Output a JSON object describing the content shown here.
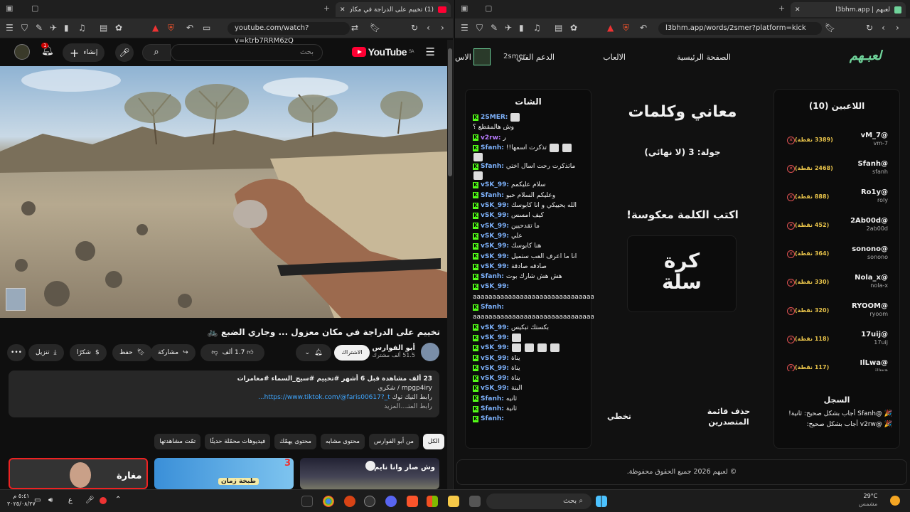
{
  "left": {
    "tab_title": "(1) تخييم على الدراجة في مكان",
    "url": "youtube.com/watch?v=ktrb7RRM6zQ",
    "yt_logo": "YouTube",
    "yt_region": "SA",
    "search_placeholder": "بحث",
    "create_label": "إنشاء",
    "notif_badge": "1",
    "video_title": "تخييم على الدراجة في مكان معزول ... وجاري الضبع 🚲",
    "channel_name": "أبو الفوارس",
    "subscribers": "51.5 ألف مشترك",
    "subscribe_label": "الاشتراك",
    "like_count": "1.7 ألف",
    "share_label": "مشاركة",
    "save_label": "حفظ",
    "thanks_label": "شكرًا",
    "download_label": "تنزيل",
    "desc_meta": "23 ألف مشاهدة  قبل 6 أشهر  #تخييم #سيج_السماء #مغامرات",
    "desc_line2": "mpgp4iry / شكري",
    "desc_link": "https://www.tiktok.com/@faris00617?_t...",
    "desc_link_prefix": "رابط التيك توك",
    "desc_more": "رابط المتـ...المزيد",
    "chips": [
      "الكل",
      "من أبو الفوارس",
      "محتوى مشابه",
      "محتوى يهمّك",
      "فيديوهات محمّلة حديثًا",
      "تمّت مشاهدتها"
    ],
    "thumb1_text": "وش صار وانا نايم ؟",
    "thumb2_text": "طبخة زمان",
    "thumb3_text": "مغارة"
  },
  "right": {
    "tab_title": "لعبهم | l3bhm.app",
    "url": "l3bhm.app/words/2smer?platform=kick",
    "logo": "لعبـهم",
    "nav": [
      "الصفحة الرئيسية",
      "الالعاب",
      "الدعم الفني",
      "الاس"
    ],
    "nav_user": "2smer",
    "players_title": "اللاعبين (10)",
    "players": [
      {
        "name": "@vM_7",
        "user": "vm-7",
        "points": "(3389 نقطة)"
      },
      {
        "name": "@Sfanh",
        "user": "sfanh",
        "points": "(2468 نقطة)"
      },
      {
        "name": "@Ro1y",
        "user": "roly",
        "points": "(888 نقطة)"
      },
      {
        "name": "@2Ab00d",
        "user": "2ab00d",
        "points": "(452 نقطة)"
      },
      {
        "name": "@sonono",
        "user": "sonono",
        "points": "(364 نقطة)"
      },
      {
        "name": "@Nola_x",
        "user": "nola-x",
        "points": "(330 نقطة)"
      },
      {
        "name": "@RYOOM",
        "user": "ryoom",
        "points": "(320 نقطة)"
      },
      {
        "name": "@17uij",
        "user": "17uij",
        "points": "(118 نقطة)"
      },
      {
        "name": "@IlLwa",
        "user": "illwa",
        "points": "(117 نقطة)"
      }
    ],
    "log_title": "السجل",
    "log": [
      "🎉 @Sfanh أجاب بشكل صحيح: ثانية!",
      "🎉 @v2rw أجاب بشكل صحيح:"
    ],
    "game_title": "معاني وكلمات",
    "round": "جولة: 3 (لا نهائي)",
    "prompt": "اكتب الكلمة معكوسة!",
    "word_line1": "كرة",
    "word_line2": "سلة",
    "clear_label": "حذف قائمة المتصدرين",
    "skip_label": "تخطي",
    "chat_title": "الشات",
    "chat": [
      {
        "u": "2SMER:",
        "t": "",
        "e": 1
      },
      {
        "u": "",
        "t": "وش هالمقطع ؟",
        "e": 0
      },
      {
        "u": "v2rw:",
        "t": "ر",
        "e": 0
      },
      {
        "u": "Sfanh:",
        "t": "تذكرت اسمها!!",
        "e": 2
      },
      {
        "u": "",
        "t": "",
        "e": 1
      },
      {
        "u": "Sfanh:",
        "t": "ماتذكرت رحت اسال اختي",
        "e": 0
      },
      {
        "u": "",
        "t": "",
        "e": 1
      },
      {
        "u": "vSK_99:",
        "t": "سلام عليكمم",
        "e": 0
      },
      {
        "u": "Sfanh:",
        "t": "وعليكم السلام حبو",
        "e": 0
      },
      {
        "u": "vSK_99:",
        "t": "الله يحييكي و انا كابوسك",
        "e": 0
      },
      {
        "u": "vSK_99:",
        "t": "كيف امسس",
        "e": 0
      },
      {
        "u": "vSK_99:",
        "t": "ما تقدحيين",
        "e": 0
      },
      {
        "u": "vSK_99:",
        "t": "علي",
        "e": 0
      },
      {
        "u": "vSK_99:",
        "t": "هنا كابوسك",
        "e": 0
      },
      {
        "u": "vSK_99:",
        "t": "انا ما اعرف العب ستميل",
        "e": 0
      },
      {
        "u": "vSK_99:",
        "t": "صادقه صادقة",
        "e": 0
      },
      {
        "u": "Sfanh:",
        "t": "هش هش شارك بوت",
        "e": 0
      },
      {
        "u": "vSK_99:",
        "t": "",
        "e": 0
      },
      {
        "u": "",
        "t": "aaaaaaaaaaaaaaaaaaaaaaaaaaaaaaaaaaaaa",
        "e": 0
      },
      {
        "u": "Sfanh:",
        "t": "",
        "e": 0
      },
      {
        "u": "",
        "t": "aaaaaaaaaaaaaaaaaaaaaaaaaaaaaaaaaaaaa",
        "e": 0
      },
      {
        "u": "vSK_99:",
        "t": "بكستك تبكيس",
        "e": 0
      },
      {
        "u": "vSK_99:",
        "t": "",
        "e": 1
      },
      {
        "u": "vSK_99:",
        "t": "",
        "e": 4
      },
      {
        "u": "vSK_99:",
        "t": "يناة",
        "e": 0
      },
      {
        "u": "vSK_99:",
        "t": "يناة",
        "e": 0
      },
      {
        "u": "vSK_99:",
        "t": "يناة",
        "e": 0
      },
      {
        "u": "vSK_99:",
        "t": "البنة",
        "e": 0
      },
      {
        "u": "Sfanh:",
        "t": "ثانيه",
        "e": 0
      },
      {
        "u": "Sfanh:",
        "t": "ثانية",
        "e": 0
      },
      {
        "u": "Sfanh:",
        "t": "",
        "e": 0
      }
    ],
    "footer": "© لعبهم 2026 جميع الحقوق محفوظة."
  },
  "taskbar": {
    "search_placeholder": "بحث",
    "weather_temp": "29°C",
    "weather_desc": "مشمس",
    "time": "٥:٤١ م",
    "date": "٢٠٢٥/٠٨/٢٧",
    "lang": "ع"
  },
  "colors": {
    "yt_red": "#ff0033",
    "kick_green": "#53fc18",
    "points": "#e8c34a",
    "logo_green": "#6fd39a"
  }
}
